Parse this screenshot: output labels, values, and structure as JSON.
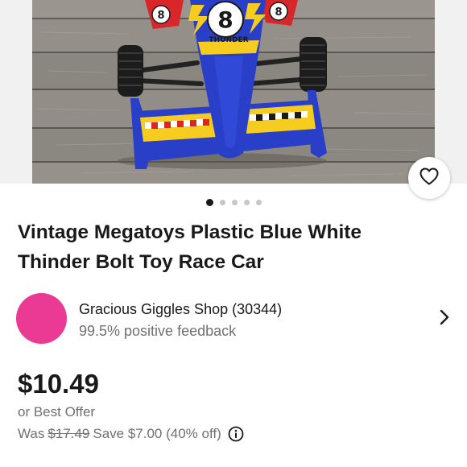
{
  "listing": {
    "title_line1": "Vintage Megatoys Plastic Blue White",
    "title_line2": "Thinder Bolt Toy Race Car",
    "car_number": "8",
    "car_decal": "THUNDER"
  },
  "carousel": {
    "count": 5,
    "active": 1
  },
  "seller": {
    "name": "Gracious Giggles Shop (30344)",
    "feedback": "99.5% positive feedback",
    "avatar_color": "#ea3a93"
  },
  "price": {
    "current": "$10.49",
    "offer": "or Best Offer",
    "was_label": "Was",
    "was_price": "$17.49",
    "savings": "Save $7.00 (40% off)"
  },
  "icons": {
    "wishlist": "heart-icon",
    "seller_nav": "chevron-right-icon",
    "discount_info": "info-icon"
  },
  "colors": {
    "car_blue": "#2a3fc7",
    "car_yellow": "#f5cc1f",
    "car_red": "#d8262a",
    "text_primary": "#191919",
    "text_secondary": "#707070"
  }
}
